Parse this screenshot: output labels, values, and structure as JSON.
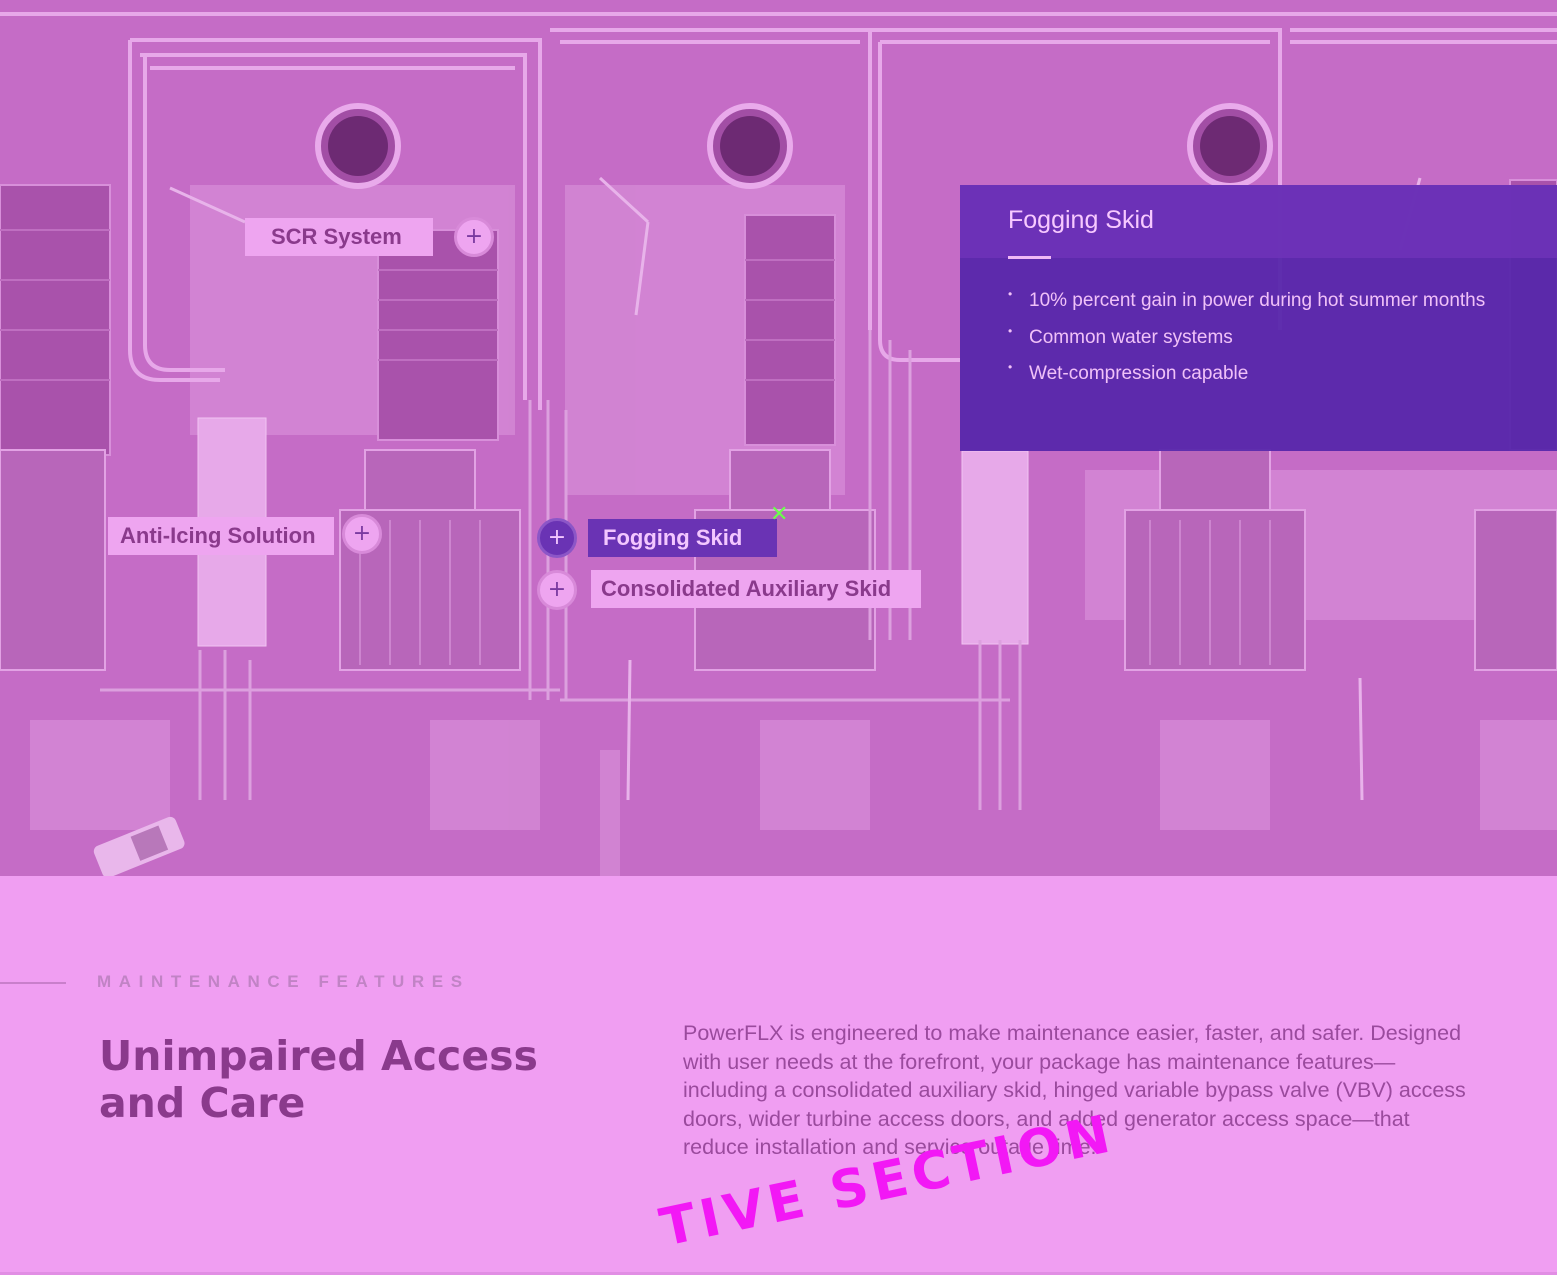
{
  "hero": {
    "hotspots": [
      {
        "label": "SCR System",
        "active": false,
        "icon": "plus-icon"
      },
      {
        "label": "Anti-Icing Solution",
        "active": false,
        "icon": "plus-icon"
      },
      {
        "label": "Fogging Skid",
        "active": true,
        "icon": "plus-icon"
      },
      {
        "label": "Consolidated Auxiliary Skid",
        "active": false,
        "icon": "plus-icon"
      }
    ],
    "close_icon": "close-icon",
    "close_glyph": "✕"
  },
  "info_panel": {
    "title": "Fogging Skid",
    "bullets": [
      "10% percent gain in power during hot summer months",
      "Common water systems",
      "Wet-compression capable"
    ]
  },
  "section": {
    "eyebrow": "MAINTENANCE FEATURES",
    "headline": "Unimpaired Access and Care",
    "body": "PowerFLX is engineered to make maintenance easier, faster, and safer. Designed with user needs at the forefront, your package has maintenance features—including a consolidated auxiliary skid, hinged variable bypass valve (VBV) access doors, wider turbine access doors, and added generator access space—that reduce installation and service outage time.",
    "overlay_label": "TIVE SECTION"
  },
  "colors": {
    "background": "#f09ef2",
    "accent": "#6a33b4",
    "heading": "#8a3a8c",
    "highlight": "#f218f5"
  }
}
